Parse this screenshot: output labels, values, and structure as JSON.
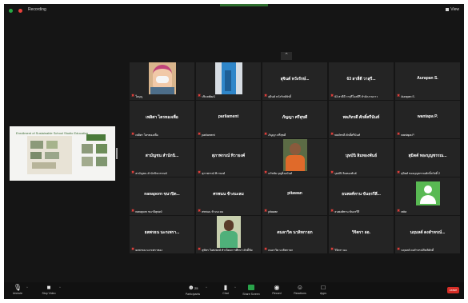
{
  "window": {
    "title": "Recording"
  },
  "top": {
    "view_label": "View"
  },
  "share": {
    "title": "Enrollment of Sustainable School Studio Education"
  },
  "participants": [
    {
      "name": "",
      "label": "ใบบุญ",
      "has_video": true,
      "video": "person-mask"
    },
    {
      "name": "",
      "label": "ปริมลพัฒน์",
      "has_video": true,
      "video": "blue-room"
    },
    {
      "name": "สุจินต์ หวังรักษ์...",
      "label": "สุจินต์ หวังรักษ์ศักดิ์",
      "has_video": false
    },
    {
      "name": "63 สาลี่ดี วาสุรี...",
      "label": "63 สาลีดี วาสุรีโอสธีรี สำนักงานกาว",
      "has_video": false
    },
    {
      "name": "Aurapan S.",
      "label": "Aurapan S.",
      "has_video": false
    },
    {
      "name": "เพลิศา ไตรทองเพื่อ",
      "label": "เพลิศา ไตรทองเพื่อ",
      "has_video": false
    },
    {
      "name": "parliament",
      "label": "parliament",
      "has_video": false
    },
    {
      "name": "ภัญญา ศรีสุขดี",
      "label": "ภัญญา ศรีสุขดี",
      "has_video": false
    },
    {
      "name": "พลภัทรดี ศักดิ์ศรีนันท์",
      "label": "พลภัทรดี ศักดิ์ศรีนันท์",
      "has_video": false
    },
    {
      "name": "wantapa P.",
      "label": "wantapa P.",
      "has_video": false
    },
    {
      "name": "สามัญชน สำนักนิ...",
      "label": "สามัญชน สำนักนิทวรรณธ์",
      "has_video": false
    },
    {
      "name": "สุภาพรรณ์ ทิวายงค์",
      "label": "สุภาพรรณ์ ทิวายงค์",
      "has_video": false
    },
    {
      "name": "",
      "label": "ธวัชชัย บุญยิ่งอนันต์",
      "has_video": true,
      "video": "person-orange"
    },
    {
      "name": "บุษบันิ ลิมทองพันธ์",
      "label": "บุษบันิ ลิมทองพันธ์",
      "has_video": false
    },
    {
      "name": "สุมิตต์ ทองบุญชรรณ...",
      "label": "สุมิตต์ ทองบุญชรรณศักดิ์สวัสดิ์ 2",
      "has_video": false
    },
    {
      "name": "nanaporn ขนาปิต...",
      "label": "nanaporn ขนาปิตุพงษ์",
      "has_video": false
    },
    {
      "name": "ศรพนน ช้างนะลม",
      "label": "ศรพนน ช้างนะลม",
      "has_video": false
    },
    {
      "name": "pitawan",
      "label": "pitawan",
      "has_video": false
    },
    {
      "name": "ธนพงศ์ทาน ขันธรรีลี...",
      "label": "ธนพงศ์ทาน ขันธรรีลี",
      "has_video": false
    },
    {
      "name": "",
      "label": "ratta",
      "has_video": false,
      "video": "avatar-icon"
    },
    {
      "name": "ยลพรธน นะกเพรา...",
      "label": "ยลพรธน นะกเพราทอง",
      "has_video": false
    },
    {
      "name": "",
      "label": "สุพัชร วิเศษพงษ์ ทำเนียบการศึกษา ศักดิ์ชัย",
      "has_video": true,
      "video": "person-green"
    },
    {
      "name": "ดนลาวิต นวลิทกายก",
      "label": "ดนลาวิต นวลิทกายก",
      "has_video": false
    },
    {
      "name": "วิจิตรา ผอ.",
      "label": "วิจิตรา ผอ.",
      "has_video": false
    },
    {
      "name": "นฤมลต์ ดงสำหรณ์...",
      "label": "นฤมลต์ ดงสำหรณ์กิตติศักดิ์",
      "has_video": false
    }
  ],
  "toolbar": {
    "mute": "Unmute",
    "video": "Stop Video",
    "participants": "Participants",
    "participants_count": "25",
    "chat": "Chat",
    "share": "Share Screen",
    "record": "Record",
    "reactions": "Reactions",
    "apps": "Apps",
    "end": "Leave"
  },
  "colors": {
    "accent_green": "#29a34a",
    "end_red": "#d62e27",
    "mic_off": "#e8413c"
  }
}
